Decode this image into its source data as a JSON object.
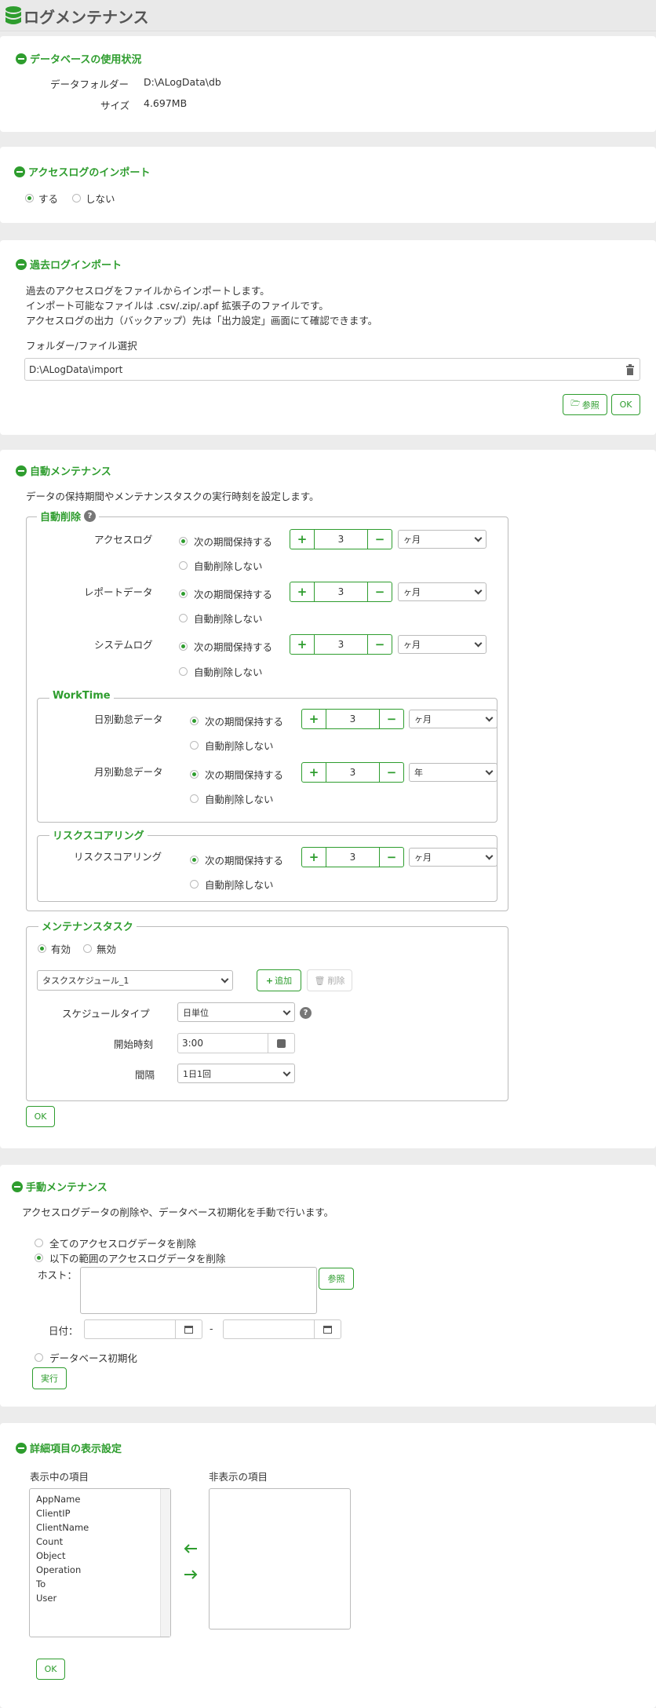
{
  "header": {
    "title": "ログメンテナンス"
  },
  "db_usage": {
    "title": "データベースの使用状況",
    "folder_label": "データフォルダー",
    "folder_value": "D:\\ALogData\\db",
    "size_label": "サイズ",
    "size_value": "4.697MB"
  },
  "access_import": {
    "title": "アクセスログのインポート",
    "opt_yes": "する",
    "opt_no": "しない"
  },
  "past_import": {
    "title": "過去ログインポート",
    "desc1": "過去のアクセスログをファイルからインポートします。",
    "desc2": "インポート可能なファイルは .csv/.zip/.apf 拡張子のファイルです。",
    "desc3": "アクセスログの出力（バックアップ）先は「出力設定」画面にて確認できます。",
    "folder_label": "フォルダー/ファイル選択",
    "path_value": "D:\\ALogData\\import",
    "browse_label": "参照",
    "ok_label": "OK"
  },
  "auto_maint": {
    "title": "自動メンテナンス",
    "desc": "データの保持期間やメンテナンスタスクの実行時刻を設定します。",
    "auto_delete": {
      "legend": "自動削除",
      "help": "?",
      "rows": [
        {
          "label": "アクセスログ",
          "keep": "次の期間保持する",
          "nodel": "自動削除しない",
          "value": "3",
          "unit": "ヶ月"
        },
        {
          "label": "レポートデータ",
          "keep": "次の期間保持する",
          "nodel": "自動削除しない",
          "value": "3",
          "unit": "ヶ月"
        },
        {
          "label": "システムログ",
          "keep": "次の期間保持する",
          "nodel": "自動削除しない",
          "value": "3",
          "unit": "ヶ月"
        }
      ]
    },
    "worktime": {
      "legend": "WorkTime",
      "rows": [
        {
          "label": "日別勤怠データ",
          "keep": "次の期間保持する",
          "nodel": "自動削除しない",
          "value": "3",
          "unit": "ヶ月"
        },
        {
          "label": "月別勤怠データ",
          "keep": "次の期間保持する",
          "nodel": "自動削除しない",
          "value": "3",
          "unit": "年"
        }
      ]
    },
    "risk": {
      "legend": "リスクスコアリング",
      "rows": [
        {
          "label": "リスクスコアリング",
          "keep": "次の期間保持する",
          "nodel": "自動削除しない",
          "value": "3",
          "unit": "ヶ月"
        }
      ]
    },
    "task": {
      "legend": "メンテナンスタスク",
      "opt_on": "有効",
      "opt_off": "無効",
      "schedule_select": "タスクスケジュール_1",
      "add_label": "追加",
      "delete_label": "削除",
      "type_label": "スケジュールタイプ",
      "type_value": "日単位",
      "start_label": "開始時刻",
      "start_value": "3:00",
      "interval_label": "間隔",
      "interval_value": "1日1回"
    },
    "ok_label": "OK"
  },
  "manual_maint": {
    "title": "手動メンテナンス",
    "desc": "アクセスログデータの削除や、データベース初期化を手動で行います。",
    "opt_all": "全てのアクセスログデータを削除",
    "opt_range": "以下の範囲のアクセスログデータを削除",
    "host_label": "ホスト：",
    "browse_label": "参照",
    "date_label": "日付：",
    "date_sep": "-",
    "opt_init": "データベース初期化",
    "run_label": "実行"
  },
  "detail_display": {
    "title": "詳細項目の表示設定",
    "shown_label": "表示中の項目",
    "hidden_label": "非表示の項目",
    "shown_items": [
      "AppName",
      "ClientIP",
      "ClientName",
      "Count",
      "Object",
      "Operation",
      "To",
      "User"
    ],
    "ok_label": "OK"
  }
}
